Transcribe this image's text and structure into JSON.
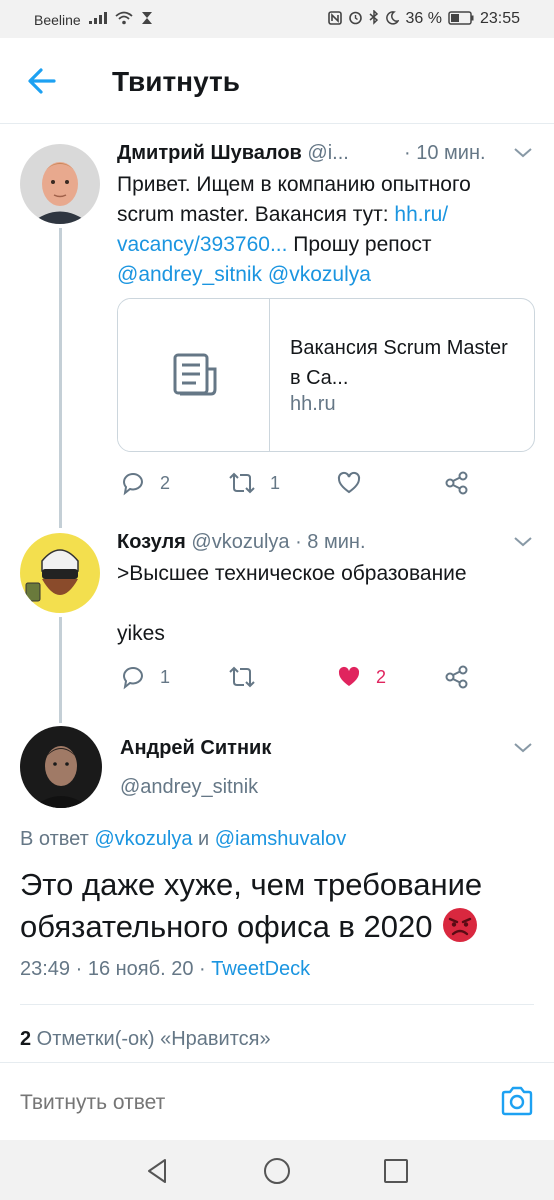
{
  "status_bar": {
    "carrier": "Beeline",
    "battery_percent": "36 %",
    "time": "23:55"
  },
  "header": {
    "back_icon": "arrow-left-icon",
    "title": "Твитнуть"
  },
  "thread": [
    {
      "author_name": "Дмитрий Шувалов",
      "author_handle": "@i...",
      "time": "· 10 мин.",
      "text_lines": [
        "Привет. Ищем в компанию опытного",
        "scrum master. Вакансия тут: "
      ],
      "link1": "hh.ru/",
      "link2": "vacancy/393760...",
      "after_link": " Прошу репост",
      "mention1": "@andrey_sitnik",
      "mention2": "@vkozulya",
      "card": {
        "title": "Вакансия Scrum Master в Ca...",
        "domain": "hh.ru"
      },
      "actions": {
        "replies": "2",
        "retweets": "1",
        "likes": ""
      }
    },
    {
      "author_name": "Козуля",
      "author_handle": "@vkozulya",
      "time": "· 8 мин.",
      "text_line1": ">Высшее техническое образование",
      "text_line2": "yikes",
      "actions": {
        "replies": "1",
        "retweets": "",
        "likes": "2"
      }
    }
  ],
  "main_tweet": {
    "author_name": "Андрей Ситник",
    "author_handle": "@andrey_sitnik",
    "reply_prefix": "В ответ",
    "reply_mention1": "@vkozulya",
    "reply_and": " и ",
    "reply_mention2": "@iamshuvalov",
    "text": "Это даже хуже, чем требование обязательного офиса в 2020",
    "emoji_icon": "angry-face-icon",
    "time": "23:49 · 16 нояб. 20 · ",
    "source": "TweetDeck",
    "likes_count": "2",
    "likes_label": " Отметки(-ок) «Нравится»"
  },
  "reply_bar": {
    "placeholder": "Твитнуть ответ"
  },
  "colors": {
    "link": "#1b95e0",
    "like": "#e0245e",
    "secondary_text": "#657786"
  }
}
